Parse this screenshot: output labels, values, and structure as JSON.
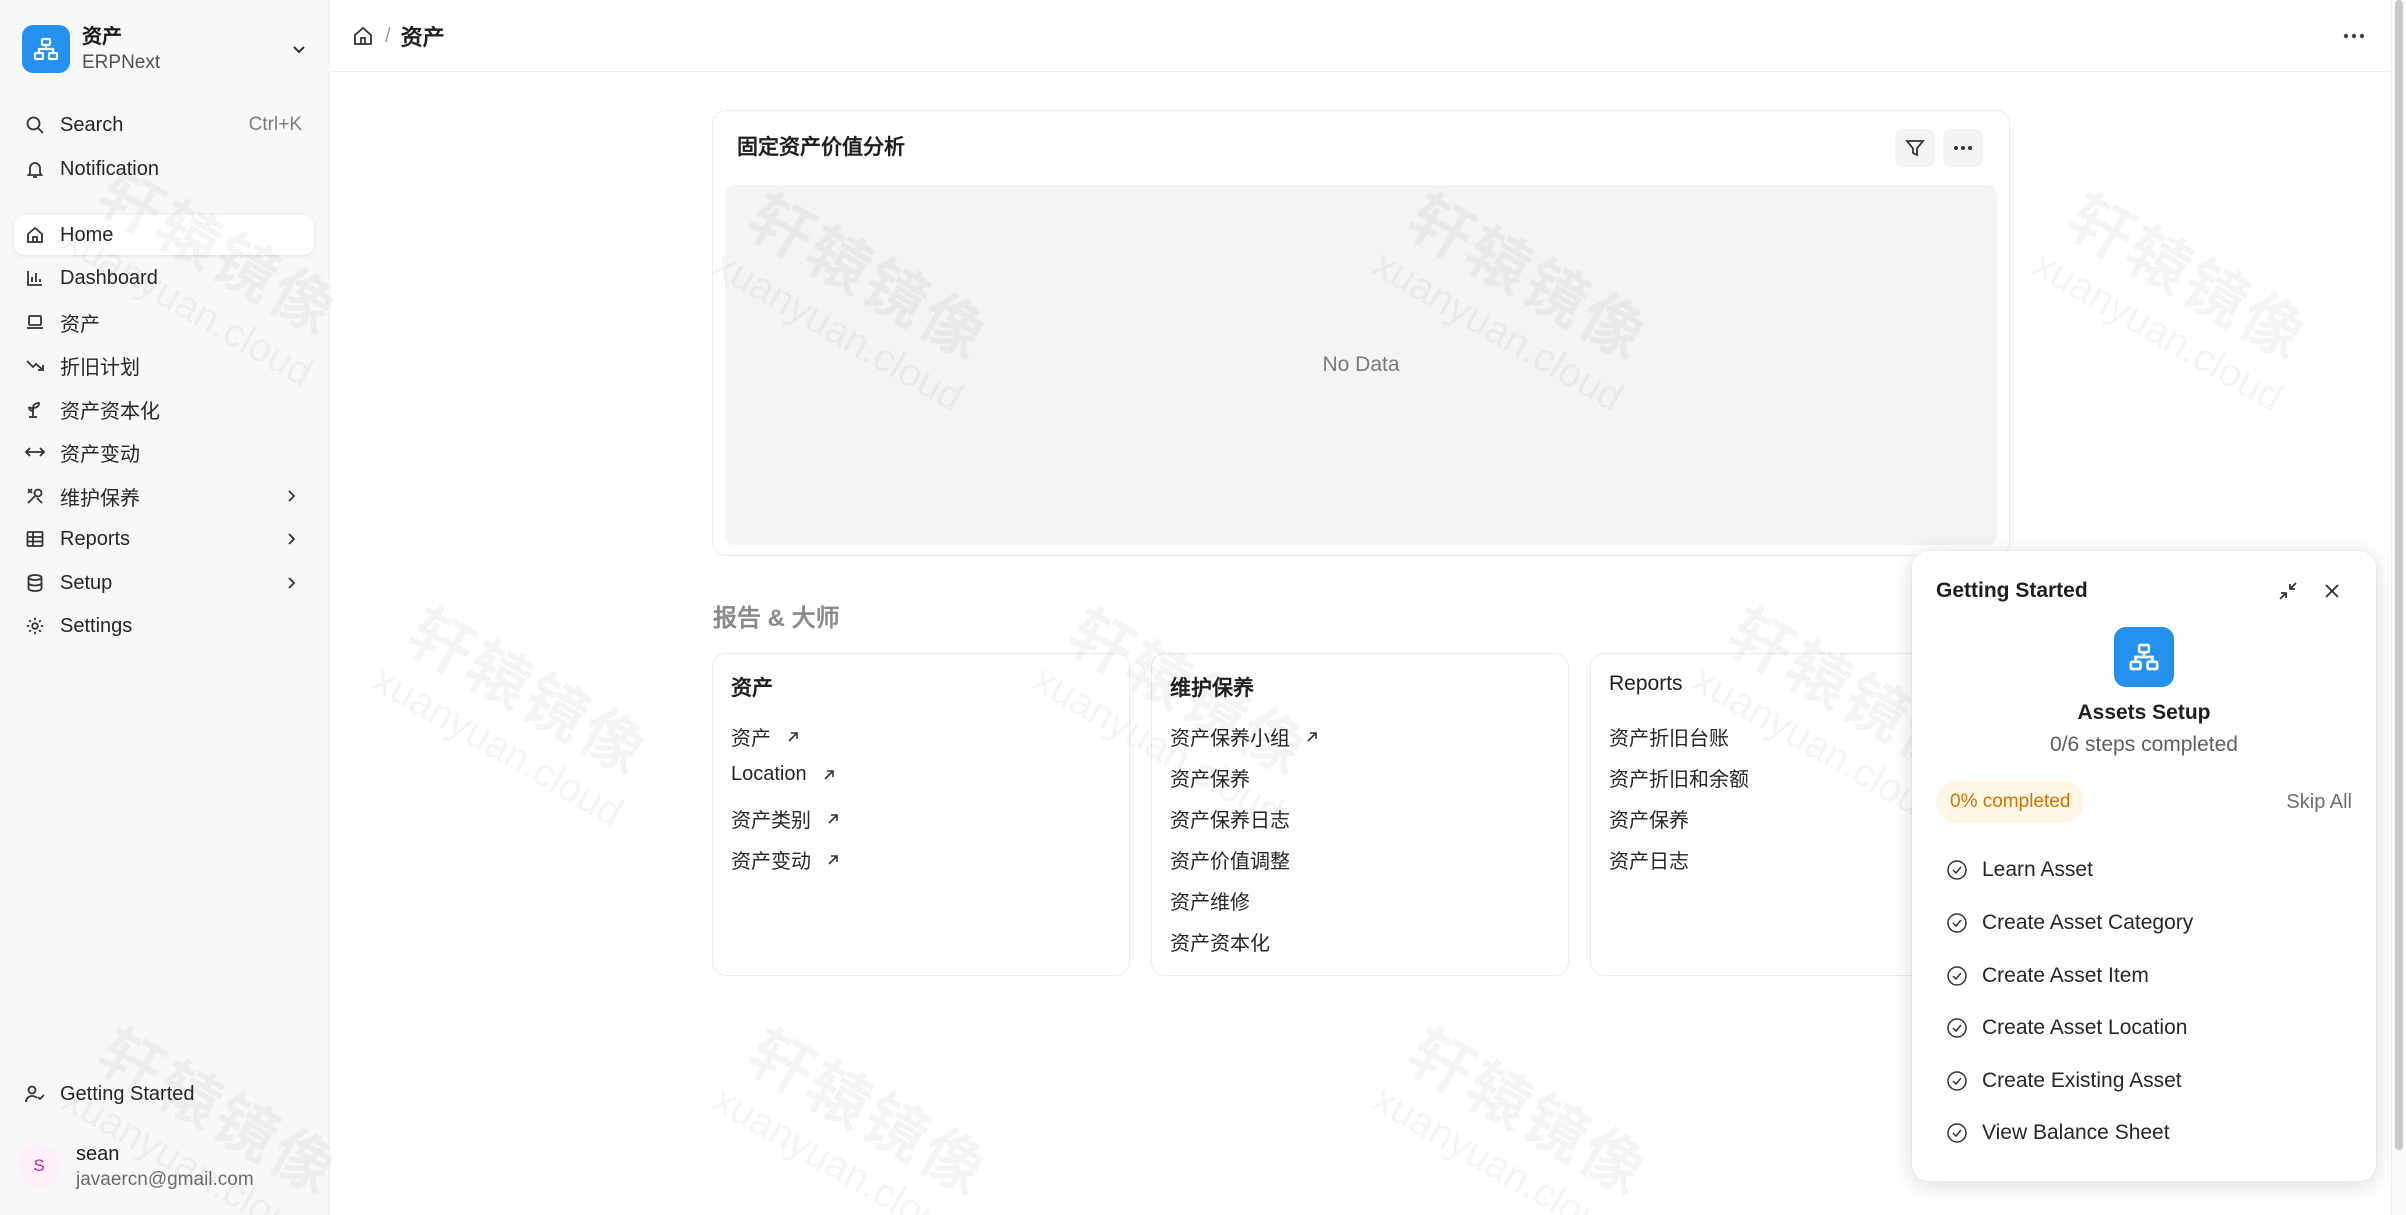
{
  "app": {
    "title": "资产",
    "subtitle": "ERPNext",
    "brand_color": "#2490ef"
  },
  "sidebar": {
    "search_label": "Search",
    "search_shortcut": "Ctrl+K",
    "notification_label": "Notification",
    "items": [
      {
        "label": "Home",
        "icon": "home-icon",
        "active": true
      },
      {
        "label": "Dashboard",
        "icon": "bar-chart-icon"
      },
      {
        "label": "资产",
        "icon": "laptop-icon"
      },
      {
        "label": "折旧计划",
        "icon": "trend-down-icon"
      },
      {
        "label": "资产资本化",
        "icon": "sprout-icon"
      },
      {
        "label": "资产变动",
        "icon": "arrows-horizontal-icon"
      },
      {
        "label": "维护保养",
        "icon": "tools-icon",
        "expandable": true
      },
      {
        "label": "Reports",
        "icon": "table-icon",
        "expandable": true
      },
      {
        "label": "Setup",
        "icon": "database-icon",
        "expandable": true
      },
      {
        "label": "Settings",
        "icon": "gear-icon"
      }
    ],
    "getting_started_label": "Getting Started",
    "user": {
      "initial": "S",
      "name": "sean",
      "email": "javaercn@gmail.com"
    }
  },
  "topbar": {
    "breadcrumb_separator": "/",
    "breadcrumb_current": "资产"
  },
  "chart": {
    "title": "固定资产价值分析",
    "empty_text": "No Data"
  },
  "reports_section": {
    "title": "报告 & 大师",
    "cards": [
      {
        "title": "资产",
        "links": [
          "资产",
          "Location",
          "资产类别",
          "资产变动"
        ],
        "external": [
          true,
          true,
          true,
          true
        ]
      },
      {
        "title": "维护保养",
        "links": [
          "资产保养小组",
          "资产保养",
          "资产保养日志",
          "资产价值调整",
          "资产维修",
          "资产资本化"
        ],
        "external": [
          true,
          false,
          false,
          false,
          false,
          false
        ]
      },
      {
        "title": "Reports",
        "links": [
          "资产折旧台账",
          "资产折旧和余额",
          "资产保养",
          "资产日志"
        ],
        "external": [
          false,
          false,
          false,
          false
        ]
      }
    ]
  },
  "getting_started": {
    "title": "Getting Started",
    "setup_name": "Assets Setup",
    "steps_completed": "0/6 steps completed",
    "progress_badge": "0% completed",
    "progress_value": 0,
    "skip_all": "Skip All",
    "steps": [
      "Learn Asset",
      "Create Asset Category",
      "Create Asset Item",
      "Create Asset Location",
      "Create Existing Asset",
      "View Balance Sheet"
    ]
  },
  "watermark": {
    "text_cn": "轩辕镜像",
    "text_en": "xuanyuan.cloud"
  }
}
